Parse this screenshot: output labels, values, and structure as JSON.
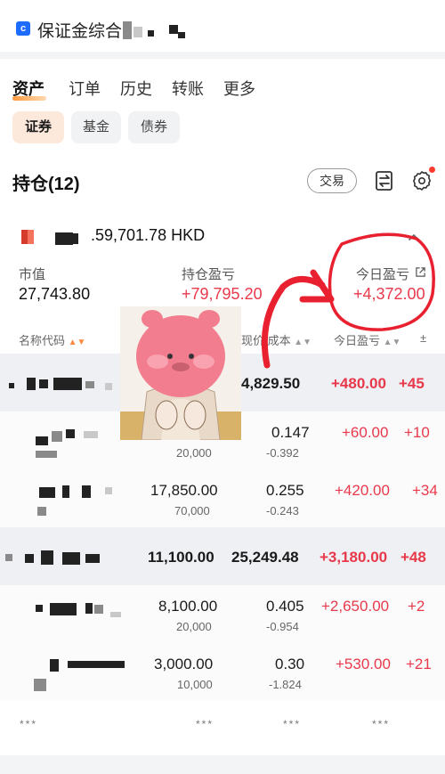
{
  "app_bar": {
    "title": "保证金综合"
  },
  "tabs": [
    {
      "label": "资产",
      "active": true
    },
    {
      "label": "订单"
    },
    {
      "label": "历史"
    },
    {
      "label": "转账"
    },
    {
      "label": "更多"
    }
  ],
  "sub_tabs": [
    {
      "label": "证券",
      "active": true
    },
    {
      "label": "基金"
    },
    {
      "label": "债券"
    }
  ],
  "positions": {
    "title": "持仓(12)",
    "trade_button": "交易"
  },
  "account": {
    "total": ".59,701.78 HKD",
    "summary": [
      {
        "label": "市值",
        "value": "27,743.80"
      },
      {
        "label": "持仓盈亏",
        "value": "+79,795.20"
      },
      {
        "label": "今日盈亏",
        "value": "+4,372.00"
      }
    ]
  },
  "columns": [
    "名称代码",
    "现价/成本",
    "今日盈亏"
  ],
  "rows": [
    {
      "qty": "",
      "qty_sub": "",
      "price": "4,829.50",
      "cost": "",
      "today": "+480.00",
      "extra": "+45",
      "group": true
    },
    {
      "qty": "",
      "qty_sub": "20,000",
      "price": "0.147",
      "cost": "-0.392",
      "today": "+60.00",
      "extra": "+10",
      "group": false
    },
    {
      "qty": "17,850.00",
      "qty_sub": "70,000",
      "price": "0.255",
      "cost": "-0.243",
      "today": "+420.00",
      "extra": "+34",
      "group": false
    },
    {
      "qty": "11,100.00",
      "qty_sub": "",
      "price": "25,249.48",
      "cost": "",
      "today": "+3,180.00",
      "extra": "+48",
      "group": true
    },
    {
      "qty": "8,100.00",
      "qty_sub": "20,000",
      "price": "0.405",
      "cost": "-0.954",
      "today": "+2,650.00",
      "extra": "+2",
      "group": false
    },
    {
      "qty": "3,000.00",
      "qty_sub": "10,000",
      "price": "0.30",
      "cost": "-1.824",
      "today": "+530.00",
      "extra": "+21",
      "group": false
    }
  ],
  "footer_masks": [
    "***",
    "***",
    "***",
    "***"
  ],
  "colors": {
    "gain": "#e8394b",
    "accent": "#ff8a3d",
    "annotation": "#e8202f"
  },
  "icons": [
    "transfer-icon",
    "settings-icon",
    "share-icon",
    "chevron-up-icon",
    "sort-icon"
  ]
}
